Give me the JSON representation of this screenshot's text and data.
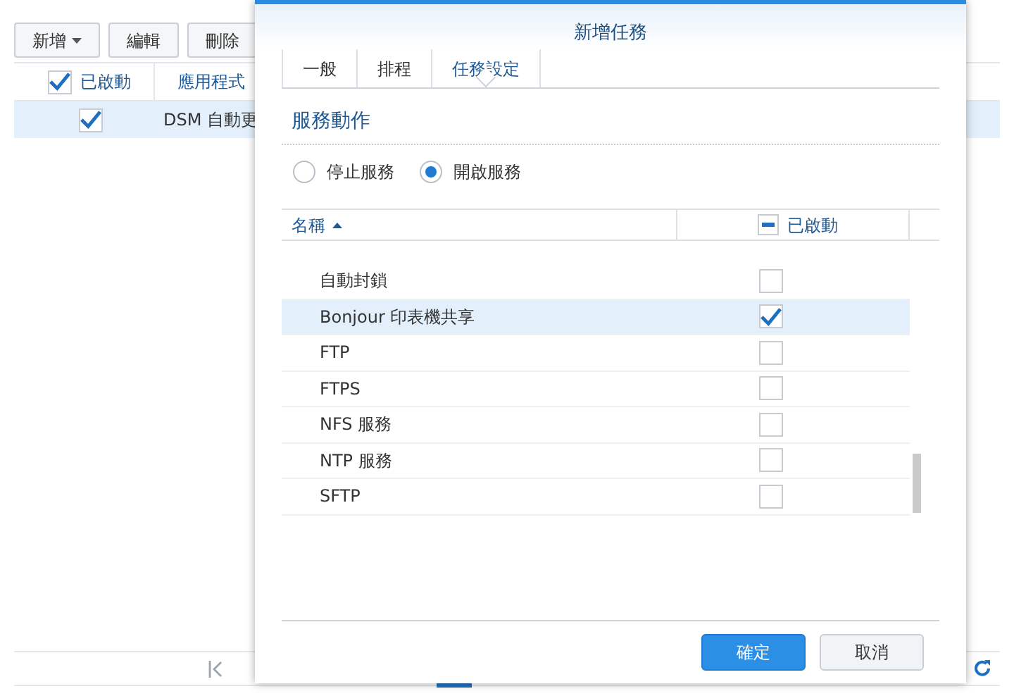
{
  "toolbar": {
    "buttons": [
      {
        "label": "新增",
        "dropdown": true
      },
      {
        "label": "編輯",
        "dropdown": false
      },
      {
        "label": "刪除",
        "dropdown": false
      }
    ]
  },
  "table": {
    "columns": [
      "已啟動",
      "應用程式"
    ],
    "header_checked": true,
    "rows": [
      {
        "checked": true,
        "selected": true,
        "name": "DSM 自動更"
      }
    ]
  },
  "dialog": {
    "title": "新增任務",
    "tabs": [
      {
        "label": "一般",
        "selected": false
      },
      {
        "label": "排程",
        "selected": false
      },
      {
        "label": "任務設定",
        "selected": true
      }
    ],
    "section": "服務動作",
    "radios": [
      {
        "label": "停止服務",
        "selected": false
      },
      {
        "label": "開啟服務",
        "selected": true
      }
    ],
    "grid": {
      "columns": [
        {
          "label": "名稱",
          "sorted": true
        },
        {
          "label": "已啟動",
          "indeterminate": true
        }
      ],
      "rows": [
        {
          "name": "自動封鎖",
          "checked": false,
          "selected": false
        },
        {
          "name": "Bonjour 印表機共享",
          "checked": true,
          "selected": true
        },
        {
          "name": "FTP",
          "checked": false,
          "selected": false
        },
        {
          "name": "FTPS",
          "checked": false,
          "selected": false
        },
        {
          "name": "NFS 服務",
          "checked": false,
          "selected": false
        },
        {
          "name": "NTP 服務",
          "checked": false,
          "selected": false
        },
        {
          "name": "SFTP",
          "checked": false,
          "selected": false
        }
      ]
    },
    "buttons": [
      {
        "label": "確定",
        "kind": "primary"
      },
      {
        "label": "取消",
        "kind": "secondary"
      }
    ]
  }
}
